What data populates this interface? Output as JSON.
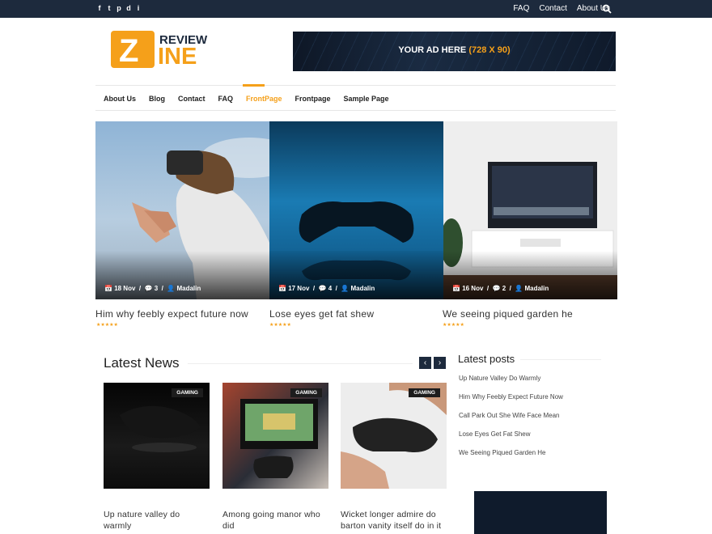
{
  "topbar": {
    "social": [
      {
        "icon": "facebook-icon",
        "glyph": "f"
      },
      {
        "icon": "twitter-icon",
        "glyph": "t"
      },
      {
        "icon": "pinterest-icon",
        "glyph": "p"
      },
      {
        "icon": "dribbble-icon",
        "glyph": "d"
      },
      {
        "icon": "instagram-icon",
        "glyph": "i"
      }
    ],
    "links": [
      "FAQ",
      "Contact",
      "About Us"
    ]
  },
  "logo": {
    "top": "REVIEW",
    "mark": "Z",
    "bottom": "INE"
  },
  "ad": {
    "text": "YOUR AD HERE",
    "size": "(728 X 90)"
  },
  "nav": {
    "items": [
      "About Us",
      "Blog",
      "Contact",
      "FAQ",
      "FrontPage",
      "Frontpage",
      "Sample Page"
    ],
    "active": "FrontPage"
  },
  "slider": [
    {
      "date": "18 Nov",
      "comments": "3",
      "author": "Madalin",
      "title": "Him why feebly expect future now"
    },
    {
      "date": "17 Nov",
      "comments": "4",
      "author": "Madalin",
      "title": "Lose eyes get fat shew"
    },
    {
      "date": "16 Nov",
      "comments": "2",
      "author": "Madalin",
      "title": "We seeing piqued garden he"
    }
  ],
  "latest_news": {
    "heading": "Latest News",
    "cards": [
      {
        "tag": "GAMING",
        "title": "Up nature valley do warmly"
      },
      {
        "tag": "GAMING",
        "title": "Among going manor who did"
      },
      {
        "tag": "GAMING",
        "title": "Wicket longer admire do barton vanity itself do in it"
      }
    ]
  },
  "sidebar": {
    "heading": "Latest posts",
    "posts": [
      "Up Nature Valley Do Warmly",
      "Him Why Feebly Expect Future Now",
      "Call Park Out She Wife Face Mean",
      "Lose Eyes Get Fat Shew",
      "We Seeing Piqued Garden He"
    ]
  },
  "colors": {
    "accent": "#f5a01a",
    "dark": "#1d2a3d"
  }
}
